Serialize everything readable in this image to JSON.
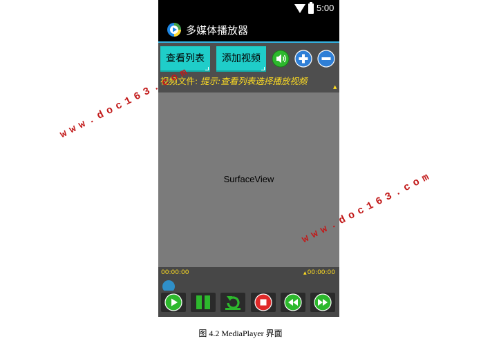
{
  "status_bar": {
    "time": "5:00",
    "icons": [
      "wifi-icon",
      "battery-icon"
    ]
  },
  "app_bar": {
    "title": "多媒体播放器",
    "icon": "media-player-logo-icon"
  },
  "toolbar": {
    "list_label": "查看列表",
    "add_label": "添加视频",
    "icons": [
      "volume-icon",
      "plus-icon",
      "minus-icon"
    ]
  },
  "info": {
    "label": "视频文件:",
    "hint": "提示:查看列表选择播放视频"
  },
  "surface": {
    "label": "SurfaceView"
  },
  "progress": {
    "current": "00:00:00",
    "total": "00:00:00",
    "value": 0
  },
  "controls": [
    "play-icon",
    "pause-icon",
    "replay-icon",
    "stop-icon",
    "rewind-icon",
    "fast-forward-icon"
  ],
  "caption": "图 4.2 MediaPlayer 界面",
  "watermark": "www.doc163.com",
  "colors": {
    "accent_cyan": "#1fcdc9",
    "hint_yellow": "#ffdd22",
    "appbar_divider": "#33b5e5",
    "control_green": "#2db82d",
    "stop_red": "#e02a2a",
    "watermark_red": "#c21a1a"
  }
}
